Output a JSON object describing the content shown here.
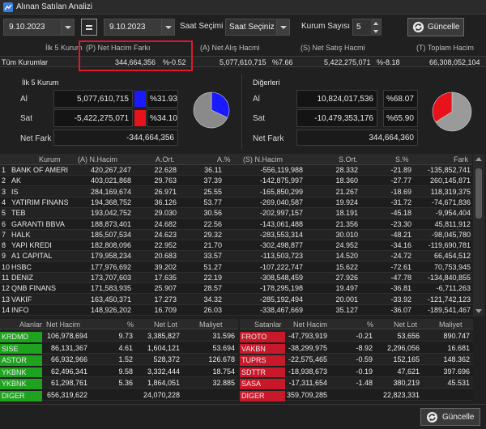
{
  "window": {
    "title": "Alınan Satılan Analizi"
  },
  "toolbar": {
    "start_date": "9.10.2023",
    "end_date": "9.10.2023",
    "time_label": "Saat Seçimi :",
    "time_value": "Saat Seçiniz",
    "count_label": "Kurum Sayısı :",
    "count_value": "5",
    "update_label": "Güncelle"
  },
  "summary": {
    "headers": [
      "İlk 5 Kurum",
      "(P) Net Hacim Farkı",
      "(A) Net Alış Hacmi",
      "(S) Net Satış Hacmi",
      "(T) Toplam Hacim"
    ],
    "row": {
      "name": "Tüm Kurumlar",
      "net_diff": "344,664,356",
      "net_diff_pct": "%-0.52",
      "buy": "5,077,610,715",
      "buy_pct": "%7.66",
      "sell": "5,422,275,071",
      "sell_pct": "%-8.18",
      "total": "66,308,052,104"
    }
  },
  "top5": {
    "title": "İlk 5 Kurum",
    "buy_label": "Al",
    "buy_value": "5,077,610,715",
    "buy_pct": "%31.93",
    "sell_label": "Sat",
    "sell_value": "-5,422,275,071",
    "sell_pct": "%34.10",
    "net_label": "Net Fark",
    "net_value": "-344,664,356",
    "pie": {
      "buy_share": 0.32,
      "buy_color": "#1a1aff",
      "sell_color": "#e8121b",
      "rest_color": "#8a8a8a"
    }
  },
  "others": {
    "title": "Diğerleri",
    "buy_label": "Al",
    "buy_value": "10,824,017,536",
    "buy_pct": "%68.07",
    "sell_label": "Sat",
    "sell_value": "-10,479,353,176",
    "sell_pct": "%65.90",
    "net_label": "Net Fark",
    "net_value": "344,664,360",
    "pie": {
      "sell_share": 0.66,
      "sell_color": "#e8121b",
      "rest_color": "#9a9a9a"
    }
  },
  "grid": {
    "headers": [
      "Kurum",
      "(A) N.Hacim",
      "A.Ort.",
      "A.%",
      "(S) N.Hacim",
      "S.Ort.",
      "S.%",
      "Fark"
    ],
    "rows": [
      [
        "1",
        "BANK OF AMERI",
        "420,267,247",
        "22.628",
        "36.11",
        "-556,119,988",
        "28.332",
        "-21.89",
        "-135,852,741"
      ],
      [
        "2",
        "AK",
        "403,021,868",
        "29.763",
        "37.39",
        "-142,875,997",
        "18.360",
        "-27.77",
        "260,145,871"
      ],
      [
        "3",
        "IS",
        "284,169,674",
        "26.971",
        "25.55",
        "-165,850,299",
        "21.267",
        "-18.69",
        "118,319,375"
      ],
      [
        "4",
        "YATIRIM FINANS",
        "194,368,752",
        "36.126",
        "53.77",
        "-269,040,587",
        "19.924",
        "-31.72",
        "-74,671,836"
      ],
      [
        "5",
        "TEB",
        "193,042,752",
        "29.030",
        "30.56",
        "-202,997,157",
        "18.191",
        "-45.18",
        "-9,954,404"
      ],
      [
        "6",
        "GARANTI BBVA",
        "188,873,401",
        "24.682",
        "22.56",
        "-143,061,488",
        "21.356",
        "-23.30",
        "45,811,912"
      ],
      [
        "7",
        "HALK",
        "185,507,534",
        "24.623",
        "29.32",
        "-283,553,314",
        "30.010",
        "-48.21",
        "-98,045,780"
      ],
      [
        "8",
        "YAPI KREDI",
        "182,808,096",
        "22.952",
        "21.70",
        "-302,498,877",
        "24.952",
        "-34.16",
        "-119,690,781"
      ],
      [
        "9",
        "A1 CAPITAL",
        "179,958,234",
        "20.683",
        "33.57",
        "-113,503,723",
        "14.520",
        "-24.72",
        "66,454,512"
      ],
      [
        "10",
        "HSBC",
        "177,976,692",
        "39.202",
        "51.27",
        "-107,222,747",
        "15.622",
        "-72.61",
        "70,753,945"
      ],
      [
        "11",
        "DENIZ",
        "173,707,603",
        "17.635",
        "22.19",
        "-308,548,459",
        "27.926",
        "-47.78",
        "-134,840,855"
      ],
      [
        "12",
        "QNB FINANS",
        "171,583,935",
        "25.907",
        "28.57",
        "-178,295,198",
        "19.497",
        "-36.81",
        "-6,711,263"
      ],
      [
        "13",
        "VAKIF",
        "163,450,371",
        "17.273",
        "34.32",
        "-285,192,494",
        "20.001",
        "-33.92",
        "-121,742,123"
      ],
      [
        "14",
        "INFO",
        "148,926,202",
        "16.709",
        "26.03",
        "-338,467,669",
        "35.127",
        "-36.07",
        "-189,541,467"
      ]
    ]
  },
  "buyers": {
    "headers": [
      "Alanlar",
      "Net Hacim",
      "%",
      "Net Lot",
      "Maliyet"
    ],
    "rows": [
      [
        "KRDMD",
        "106,978,694",
        "9.73",
        "3,385,827",
        "31.596"
      ],
      [
        "SISE",
        "86,131,367",
        "4.61",
        "1,604,121",
        "53.694"
      ],
      [
        "ASTOR",
        "66,932,966",
        "1.52",
        "528,372",
        "126.678"
      ],
      [
        "YKBNK",
        "62,496,341",
        "9.58",
        "3,332,444",
        "18.754"
      ],
      [
        "YKBNK",
        "61,298,761",
        "5.36",
        "1,864,051",
        "32.885"
      ],
      [
        "DIGER",
        "656,319,622",
        "",
        "24,070,228",
        ""
      ]
    ],
    "colors": [
      "#1fa31f",
      "#1fa31f",
      "#1fa31f",
      "#1fa31f",
      "#1fa31f",
      "#1fa31f"
    ]
  },
  "sellers": {
    "headers": [
      "Satanlar",
      "Net Hacim",
      "%",
      "Net Lot",
      "Maliyet"
    ],
    "rows": [
      [
        "FROTO",
        "-47,793,919",
        "-0.21",
        "53,656",
        "890.747"
      ],
      [
        "VAKBN",
        "-38,299,975",
        "-8.92",
        "2,296,056",
        "16.681"
      ],
      [
        "TUPRS",
        "-22,575,465",
        "-0.59",
        "152,165",
        "148.362"
      ],
      [
        "SDTTR",
        "-18,938,673",
        "-0.19",
        "47,621",
        "397.696"
      ],
      [
        "SASA",
        "-17,311,654",
        "-1.48",
        "380,219",
        "45.531"
      ],
      [
        "DIGER",
        "359,709,285",
        "",
        "22,823,331",
        ""
      ]
    ],
    "colors": [
      "#c8192a",
      "#c8192a",
      "#c8192a",
      "#c8192a",
      "#c8192a",
      "#c8192a"
    ]
  },
  "bottom": {
    "update_label": "Güncelle"
  }
}
